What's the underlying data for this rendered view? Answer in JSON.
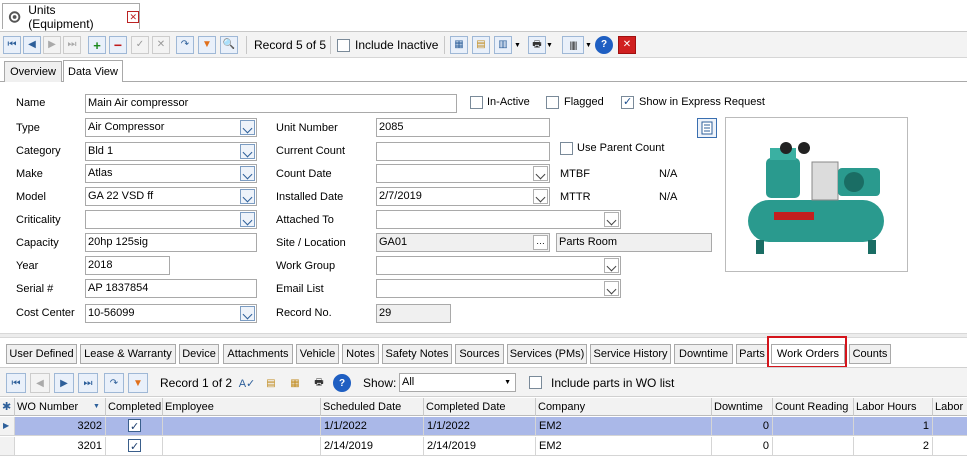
{
  "window": {
    "title": "Units (Equipment)"
  },
  "toolbar": {
    "record": "Record 5 of 5",
    "include_inactive": "Include Inactive",
    "buttons": [
      "first",
      "prev",
      "next",
      "last",
      "add",
      "delete",
      "save",
      "cancel",
      "refresh",
      "filter",
      "search"
    ]
  },
  "tabs": {
    "overview": "Overview",
    "data_view": "Data View"
  },
  "form": {
    "name_label": "Name",
    "name_value": "Main Air  compressor",
    "inactive_label": "In-Active",
    "flagged_label": "Flagged",
    "express_label": "Show in Express Request",
    "type_label": "Type",
    "type_value": "Air Compressor",
    "category_label": "Category",
    "category_value": "Bld 1",
    "make_label": "Make",
    "make_value": "Atlas",
    "model_label": "Model",
    "model_value": "GA 22 VSD ff",
    "criticality_label": "Criticality",
    "criticality_value": "",
    "capacity_label": "Capacity",
    "capacity_value": "20hp 125sig",
    "year_label": "Year",
    "year_value": "2018",
    "serial_label": "Serial #",
    "serial_value": "AP 1837854",
    "cost_center_label": "Cost Center",
    "cost_center_value": "10-56099",
    "unit_number_label": "Unit Number",
    "unit_number_value": "2085",
    "current_count_label": "Current Count",
    "current_count_value": "",
    "use_parent_label": "Use Parent Count",
    "count_date_label": "Count Date",
    "count_date_value": "",
    "mtbf_label": "MTBF",
    "mtbf_value": "N/A",
    "installed_label": "Installed Date",
    "installed_value": "2/7/2019",
    "mttr_label": "MTTR",
    "mttr_value": "N/A",
    "attached_label": "Attached To",
    "attached_value": "",
    "site_label": "Site / Location",
    "site_value": "GA01",
    "location_value": "Parts Room",
    "work_group_label": "Work Group",
    "work_group_value": "",
    "email_label": "Email List",
    "email_value": "",
    "record_no_label": "Record No.",
    "record_no_value": "29"
  },
  "bottom_tabs": [
    "User Defined",
    "Lease & Warranty",
    "Device",
    "Attachments",
    "Vehicle",
    "Notes",
    "Safety Notes",
    "Sources",
    "Services (PMs)",
    "Service History",
    "Downtime",
    "Parts",
    "Work Orders",
    "Counts"
  ],
  "sub_toolbar": {
    "record": "Record 1 of 2",
    "show_label": "Show:",
    "show_value": "All",
    "include_parts": "Include parts in WO list"
  },
  "grid": {
    "columns": [
      "WO Number",
      "Completed",
      "Employee",
      "Scheduled Date",
      "Completed Date",
      "Company",
      "Downtime",
      "Count Reading",
      "Labor Hours",
      "Labor"
    ],
    "rows": [
      {
        "wo": "3202",
        "employee": "",
        "scheduled": "1/1/2022",
        "completed_date": "1/1/2022",
        "company": "EM2",
        "downtime": "0",
        "count": "",
        "labor_hours": "1"
      },
      {
        "wo": "3201",
        "employee": "",
        "scheduled": "2/14/2019",
        "completed_date": "2/14/2019",
        "company": "EM2",
        "downtime": "0",
        "count": "",
        "labor_hours": "2"
      }
    ]
  },
  "colors": {
    "accent": "#3a6fb0",
    "selected_row": "#aab8e8",
    "highlight": "#d4141b"
  }
}
